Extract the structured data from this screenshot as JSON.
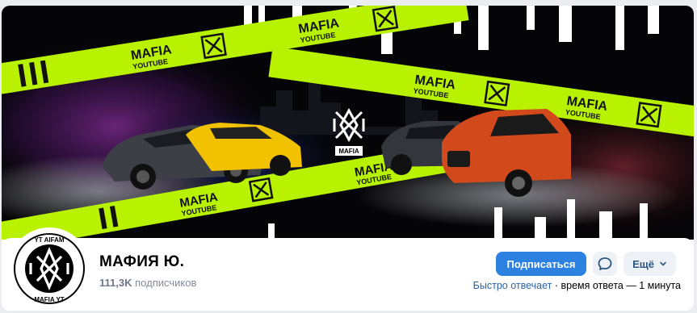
{
  "cover": {
    "brand_text": "MAFIA",
    "brand_sub": "YOUTUBE",
    "tape_top": "MAFIA",
    "tape_sub": "YOUTUBE"
  },
  "community": {
    "name": "МАФИЯ Ю.",
    "subscribers_count": "111,3K",
    "subscribers_label": "подписчиков",
    "avatar_text": "MAFIA YT"
  },
  "actions": {
    "subscribe_label": "Подписаться",
    "more_label": "Ещё"
  },
  "status": {
    "fast_reply": "Быстро отвечает",
    "separator": " · ",
    "response_time": "время ответа — 1 минута"
  },
  "colors": {
    "accent": "#2d81e0",
    "tape": "#b8f200",
    "link": "#2d64a3"
  }
}
